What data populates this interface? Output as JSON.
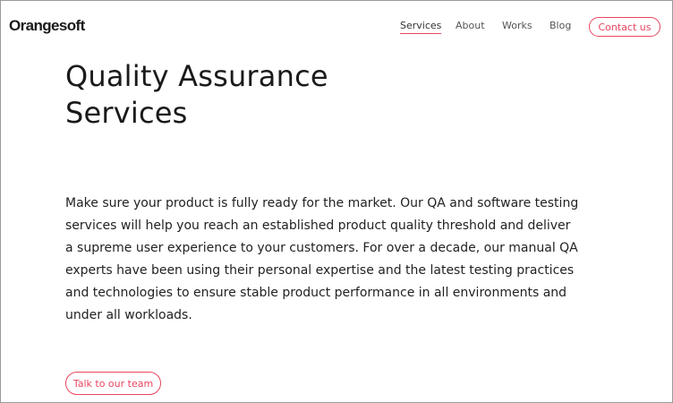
{
  "header": {
    "logo": "Orangesoft",
    "nav": {
      "services": "Services",
      "about": "About",
      "works": "Works",
      "blog": "Blog"
    },
    "contact_label": "Contact us"
  },
  "hero": {
    "title_lines": [
      "Quality Assurance",
      "Services"
    ],
    "description_lines": [
      "Make sure your product is fully ready for the market. Our QA and software testing",
      "services will help you reach an established product quality threshold and deliver",
      "a supreme user experience to your customers. For over a decade, our manual QA",
      "experts have been using their personal expertise and the latest testing practices",
      "and technologies to ensure stable product performance in all environments and",
      "under all workloads."
    ],
    "cta_label": "Talk to our team"
  },
  "colors": {
    "accent": "#e8455f",
    "text": "#1a1a1a",
    "nav_text": "#555555"
  }
}
